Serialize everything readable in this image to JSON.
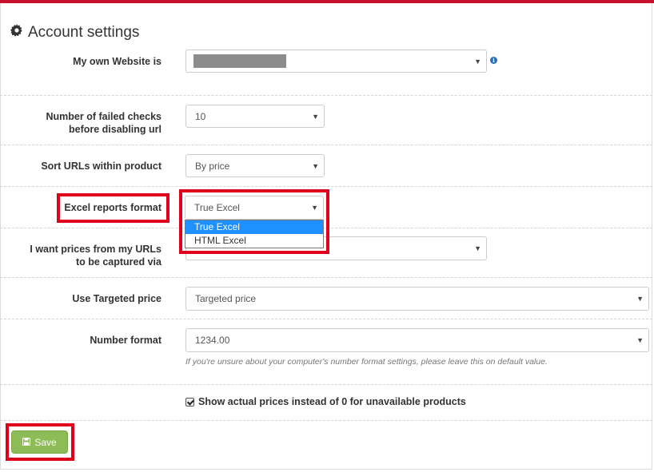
{
  "section": {
    "title": "Account settings",
    "title_icon": "gear-icon"
  },
  "fields": {
    "website": {
      "label": "My own Website is",
      "value_redacted": true,
      "info_icon": "info-icon"
    },
    "failed_checks": {
      "label_line1": "Number of failed checks",
      "label_line2": "before disabling url",
      "value": "10"
    },
    "sort_urls": {
      "label": "Sort URLs within product",
      "value": "By price"
    },
    "excel_format": {
      "label": "Excel reports format",
      "value": "True Excel",
      "options": [
        "True Excel",
        "HTML Excel"
      ],
      "selected_index": 0
    },
    "price_capture": {
      "label_line1": "I want prices from my URLs",
      "label_line2": "to be captured via"
    },
    "targeted_price": {
      "label": "Use Targeted price",
      "value": "Targeted price"
    },
    "number_format": {
      "label": "Number format",
      "value": "1234.00",
      "hint": "If you're unsure about your computer's number format settings, please leave this on default value."
    },
    "show_actual_prices": {
      "label": "Show actual prices instead of 0 for unavailable products",
      "checked": true
    }
  },
  "actions": {
    "save_label": "Save",
    "save_icon": "floppy-disk-icon"
  },
  "colors": {
    "accent_red": "#e0001b",
    "save_green": "#8dbb55",
    "dropdown_highlight": "#1e90ff",
    "info_blue": "#2a6fb5"
  }
}
